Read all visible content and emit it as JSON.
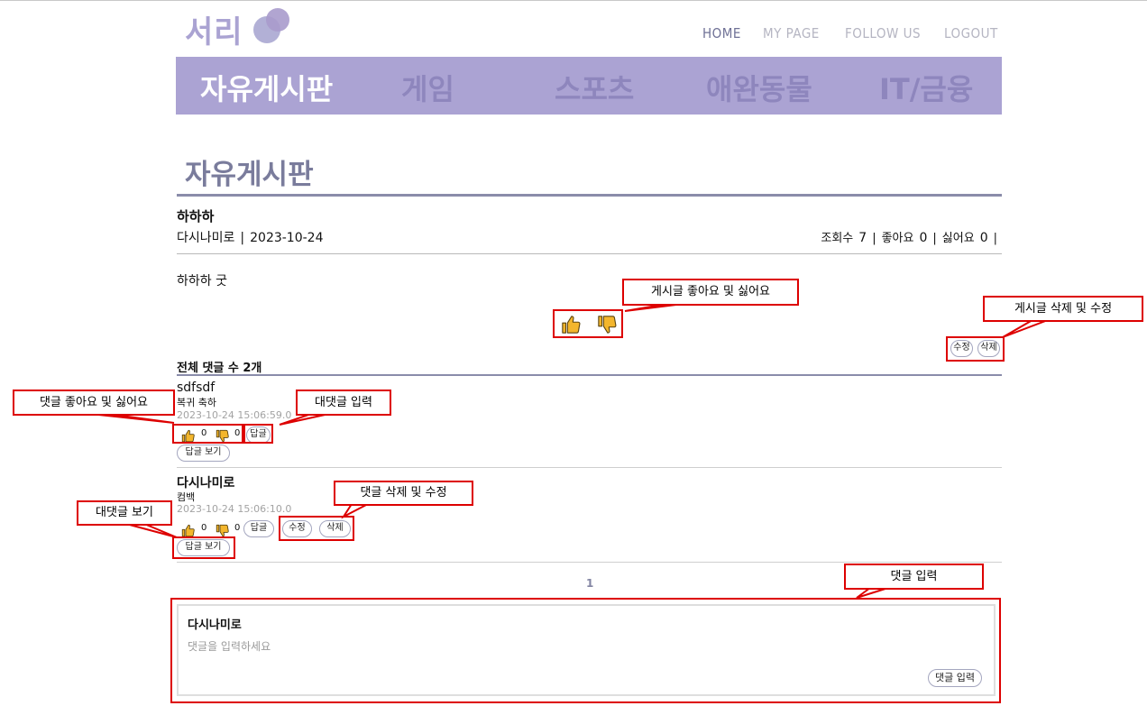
{
  "logo": {
    "text": "서리"
  },
  "top_nav": [
    "HOME",
    "MY PAGE",
    "FOLLOW US",
    "LOGOUT"
  ],
  "categories": [
    "자유게시판",
    "게임",
    "스포츠",
    "애완동물",
    "IT/금융"
  ],
  "board_title": "자유게시판",
  "post": {
    "title": "하하하",
    "author": "다시나미로",
    "date": "2023-10-24",
    "views_label": "조회수",
    "views": "7",
    "likes_label": "좋아요",
    "likes": "0",
    "dislikes_label": "싫어요",
    "dislikes": "0",
    "body": "하하하 굿",
    "edit_label": "수정",
    "delete_label": "삭제"
  },
  "comments_header": "전체 댓글 수 2개",
  "comments": [
    {
      "author": "sdfsdf",
      "text": "복귀 축하",
      "time": "2023-10-24 15:06:59.0",
      "likes": "0",
      "dislikes": "0",
      "reply_label": "답글",
      "view_replies_label": "답글 보기"
    },
    {
      "author": "다시나미로",
      "text": "컴백",
      "time": "2023-10-24 15:06:10.0",
      "likes": "0",
      "dislikes": "0",
      "reply_label": "답글",
      "edit_label": "수정",
      "delete_label": "삭제",
      "view_replies_label": "답글 보기"
    }
  ],
  "pagination": {
    "current": "1"
  },
  "comment_input": {
    "user": "다시나미로",
    "placeholder": "댓글을 입력하세요",
    "submit_label": "댓글 입력"
  },
  "annotations": {
    "post_like_dislike": "게시글 좋아요 및 싫어요",
    "post_edit_delete": "게시글 삭제 및 수정",
    "comment_like_dislike": "댓글 좋아요 및 싫어요",
    "reply_input": "대댓글 입력",
    "comment_edit_delete": "댓글 삭제 및 수정",
    "view_replies": "대댓글 보기",
    "comment_input": "댓글 입력"
  },
  "colors": {
    "brand": "#aba3d3",
    "nav_active": "#6f7196",
    "nav_inactive": "#b5b5c2",
    "thumb": "#f3b62d",
    "annotation": "#dd0000"
  },
  "icons": [
    "thumbs-up-icon",
    "thumbs-down-icon"
  ]
}
